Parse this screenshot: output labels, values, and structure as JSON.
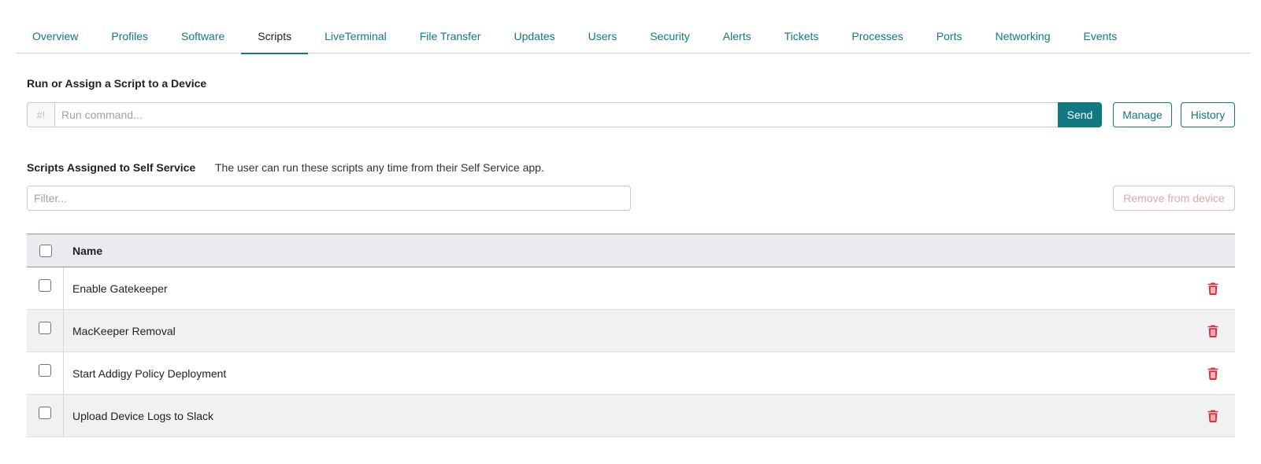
{
  "tabs": [
    {
      "label": "Overview",
      "active": false
    },
    {
      "label": "Profiles",
      "active": false
    },
    {
      "label": "Software",
      "active": false
    },
    {
      "label": "Scripts",
      "active": true
    },
    {
      "label": "LiveTerminal",
      "active": false
    },
    {
      "label": "File Transfer",
      "active": false
    },
    {
      "label": "Updates",
      "active": false
    },
    {
      "label": "Users",
      "active": false
    },
    {
      "label": "Security",
      "active": false
    },
    {
      "label": "Alerts",
      "active": false
    },
    {
      "label": "Tickets",
      "active": false
    },
    {
      "label": "Processes",
      "active": false
    },
    {
      "label": "Ports",
      "active": false
    },
    {
      "label": "Networking",
      "active": false
    },
    {
      "label": "Events",
      "active": false
    }
  ],
  "run": {
    "title": "Run or Assign a Script to a Device",
    "prefix": "#!",
    "placeholder": "Run command...",
    "value": "",
    "send_label": "Send",
    "manage_label": "Manage",
    "history_label": "History"
  },
  "self_service": {
    "title": "Scripts Assigned to Self Service",
    "description": "The user can run these scripts any time from their Self Service app.",
    "filter_placeholder": "Filter...",
    "remove_label": "Remove from device"
  },
  "table": {
    "header": "Name",
    "rows": [
      {
        "name": "Enable Gatekeeper"
      },
      {
        "name": "MacKeeper Removal"
      },
      {
        "name": "Start Addigy Policy Deployment"
      },
      {
        "name": "Upload Device Logs to Slack"
      }
    ]
  },
  "colors": {
    "accent": "#117a80",
    "danger": "#d9333f",
    "danger_disabled": "#e3a7aa"
  },
  "icons": {
    "row_action": "trash-icon"
  }
}
